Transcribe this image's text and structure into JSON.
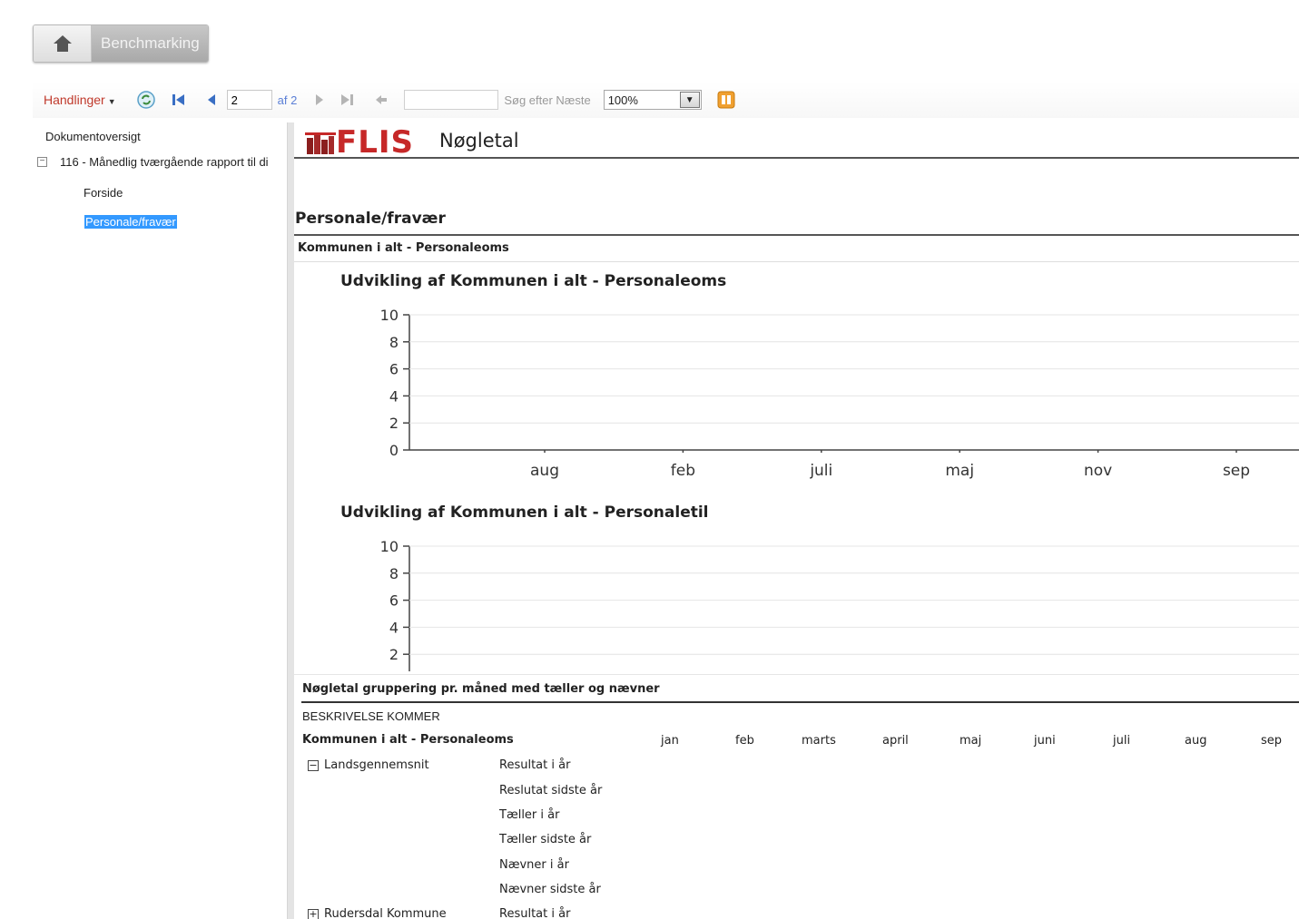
{
  "header": {
    "bench_label": "Benchmarking"
  },
  "toolbar": {
    "actions_label": "Handlinger",
    "page_value": "2",
    "page_of": "af 2",
    "search_placeholder": "",
    "search_next": "Søg efter Næste",
    "zoom": "100%"
  },
  "docmap": {
    "title": "Dokumentoversigt",
    "node_label": "116 - Månedlig tværgående rapport til di",
    "items": [
      "Forside",
      "Personale/fravær"
    ]
  },
  "report": {
    "logo": "FLIS",
    "title": "Nøgletal",
    "section_title": "Personale/fravær",
    "sub_title": "Kommunen i alt  - Personaleoms",
    "grouping_title": "Nøgletal gruppering pr. måned med tæller og nævner",
    "description": "BESKRIVELSE KOMMER",
    "table_label": "Kommunen i alt  - Personaleoms",
    "months": [
      "jan",
      "feb",
      "marts",
      "april",
      "maj",
      "juni",
      "juli",
      "aug",
      "sep"
    ],
    "groups": [
      {
        "name": "Landsgennemsnit",
        "toggle": "⊟"
      },
      {
        "name": "Rudersdal Kommune",
        "toggle": "⊞"
      }
    ],
    "metrics": [
      "Resultat i år",
      "Reslutat sidste år",
      "Tæller i år",
      "Tæller sidste år",
      "Nævner i år",
      "Nævner sidste år",
      "Resultat i år"
    ]
  },
  "chart_data": [
    {
      "type": "line",
      "title": "Udvikling af Kommunen i alt  - Personaleoms",
      "x_ticks": [
        "aug",
        "feb",
        "juli",
        "maj",
        "nov",
        "sep"
      ],
      "y_ticks": [
        0,
        2,
        4,
        6,
        8,
        10
      ],
      "ylim": [
        0,
        10
      ],
      "grid": true,
      "series": []
    },
    {
      "type": "line",
      "title": "Udvikling af Kommunen i alt  - Personaletil",
      "x_ticks": [],
      "y_ticks": [
        2,
        4,
        6,
        8,
        10
      ],
      "ylim": [
        0,
        10
      ],
      "grid": true,
      "series": []
    }
  ]
}
